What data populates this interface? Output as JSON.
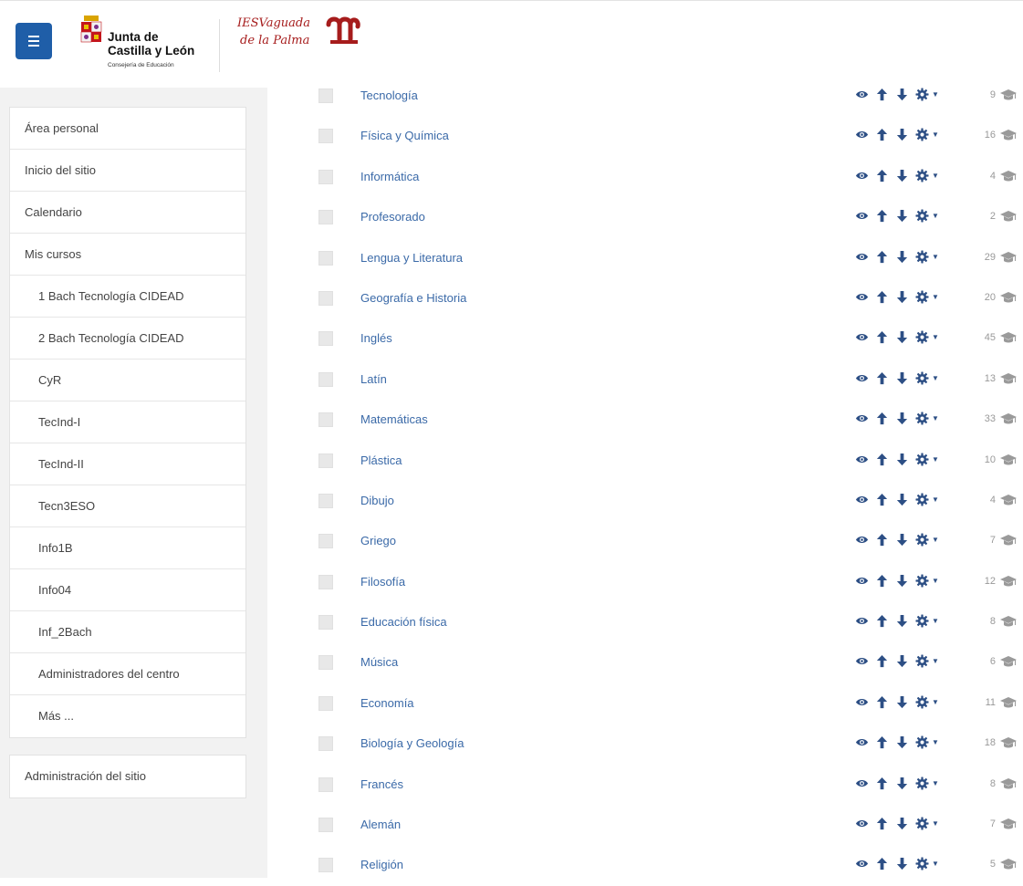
{
  "header": {
    "menu_icon": "hamburger-menu-icon",
    "jcyl": {
      "line1": "Junta de",
      "line2": "Castilla y León",
      "sub": "Consejería de Educación"
    },
    "ies": {
      "line1": "IESVaguada",
      "line2": "de la Palma"
    }
  },
  "colors": {
    "brand_blue": "#1f5ea8",
    "link": "#3b6aa8",
    "icon": "#2d4f85",
    "ies_red": "#a61c1c"
  },
  "sidebar": {
    "items": [
      {
        "label": "Área personal",
        "level": 0
      },
      {
        "label": "Inicio del sitio",
        "level": 0
      },
      {
        "label": "Calendario",
        "level": 0
      },
      {
        "label": "Mis cursos",
        "level": 0
      },
      {
        "label": "1 Bach Tecnología CIDEAD",
        "level": 1
      },
      {
        "label": "2 Bach Tecnología CIDEAD",
        "level": 1
      },
      {
        "label": "CyR",
        "level": 1
      },
      {
        "label": "TecInd-I",
        "level": 1
      },
      {
        "label": "TecInd-II",
        "level": 1
      },
      {
        "label": "Tecn3ESO",
        "level": 1
      },
      {
        "label": "Info1B",
        "level": 1
      },
      {
        "label": "Info04",
        "level": 1
      },
      {
        "label": "Inf_2Bach",
        "level": 1
      },
      {
        "label": "Administradores del centro",
        "level": 1
      },
      {
        "label": "Más ...",
        "level": 1
      }
    ],
    "admin": {
      "label": "Administración del sitio"
    }
  },
  "categories": [
    {
      "name": "Tecnología",
      "count": "9"
    },
    {
      "name": "Física y Química",
      "count": "16"
    },
    {
      "name": "Informática",
      "count": "4"
    },
    {
      "name": "Profesorado",
      "count": "2"
    },
    {
      "name": "Lengua y Literatura",
      "count": "29"
    },
    {
      "name": "Geografía e Historia",
      "count": "20"
    },
    {
      "name": "Inglés",
      "count": "45"
    },
    {
      "name": "Latín",
      "count": "13"
    },
    {
      "name": "Matemáticas",
      "count": "33"
    },
    {
      "name": "Plástica",
      "count": "10"
    },
    {
      "name": "Dibujo",
      "count": "4"
    },
    {
      "name": "Griego",
      "count": "7"
    },
    {
      "name": "Filosofía",
      "count": "12"
    },
    {
      "name": "Educación física",
      "count": "8"
    },
    {
      "name": "Música",
      "count": "6"
    },
    {
      "name": "Economía",
      "count": "11"
    },
    {
      "name": "Biología y Geología",
      "count": "18"
    },
    {
      "name": "Francés",
      "count": "8"
    },
    {
      "name": "Alemán",
      "count": "7"
    },
    {
      "name": "Religión",
      "count": "5"
    }
  ],
  "row_icons": [
    "eye-icon",
    "arrow-up-icon",
    "arrow-down-icon",
    "gear-icon",
    "caret-down-icon",
    "graduation-cap-icon"
  ]
}
